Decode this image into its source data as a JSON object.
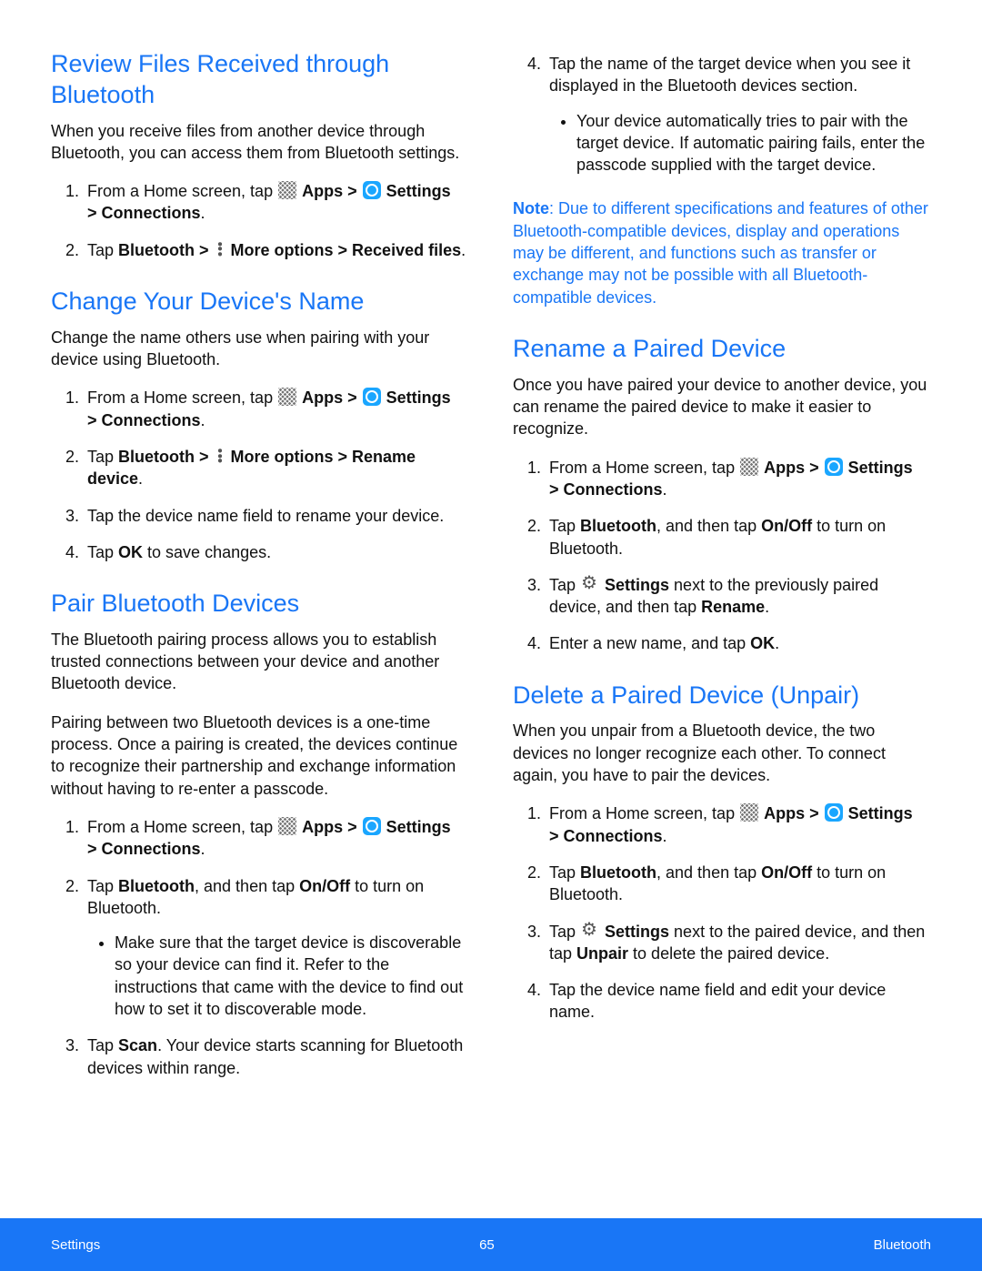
{
  "footer": {
    "left": "Settings",
    "page": "65",
    "right": "Bluetooth"
  },
  "common": {
    "apps_label": "Apps",
    "settings_label": "Settings",
    "connections": "> Connections",
    "gt": " > "
  },
  "left_col": {
    "s1": {
      "h": "Review Files Received through Bluetooth",
      "p": "When you receive files from another device through Bluetooth, you can access them from Bluetooth settings.",
      "li1_pre": "From a Home screen, tap ",
      "li1_post": ".",
      "li2_a": "Tap ",
      "li2_b": "Bluetooth > ",
      "li2_c": " More options > Received files",
      "li2_d": "."
    },
    "s2": {
      "h": "Change Your Device's Name",
      "p": "Change the name others use when pairing with your device using Bluetooth.",
      "li1_pre": "From a Home screen, tap ",
      "li2_a": "Tap ",
      "li2_b": "Bluetooth > ",
      "li2_c": " More options > Rename device",
      "li2_d": ".",
      "li3": "Tap the device name field to rename your device.",
      "li4_a": "Tap ",
      "li4_b": "OK",
      "li4_c": " to save changes."
    },
    "s3": {
      "h": "Pair Bluetooth Devices",
      "p1": "The Bluetooth pairing process allows you to establish trusted connections between your device and another Bluetooth device.",
      "p2": "Pairing between two Bluetooth devices is a one-time process. Once a pairing is created, the devices continue to recognize their partnership and exchange information without having to re-enter a passcode.",
      "li1_pre": "From a Home screen, tap ",
      "li2_a": "Tap ",
      "li2_b": "Bluetooth",
      "li2_c": ", and then tap ",
      "li2_d": "On/Off",
      "li2_e": " to turn on Bluetooth.",
      "li2_sub": "Make sure that the target device is discoverable so your device can find it. Refer to the instructions that came with the device to find out how to set it to discoverable mode.",
      "li3_a": "Tap ",
      "li3_b": "Scan",
      "li3_c": ". Your device starts scanning for Bluetooth devices within range."
    }
  },
  "right_col": {
    "s3_cont": {
      "li4": "Tap the name of the target device when you see it displayed in the Bluetooth devices section.",
      "li4_sub": "Your device automatically tries to pair with the target device. If automatic pairing fails, enter the passcode supplied with the target device."
    },
    "note_label": "Note",
    "note_body": ": Due to different specifications and features of other Bluetooth-compatible devices, display and operations may be different, and functions such as transfer or exchange may not be possible with all Bluetooth-compatible devices.",
    "s4": {
      "h": "Rename a Paired Device",
      "p": "Once you have paired your device to another device, you can rename the paired device to make it easier to recognize.",
      "li1_pre": "From a Home screen, tap ",
      "li2_a": "Tap ",
      "li2_b": "Bluetooth",
      "li2_c": ", and then tap ",
      "li2_d": "On/Off",
      "li2_e": " to turn on Bluetooth.",
      "li3_a": "Tap ",
      "li3_b": " Settings",
      "li3_c": " next to the previously paired device, and then tap ",
      "li3_d": "Rename",
      "li3_e": ".",
      "li4_a": "Enter a new name, and tap ",
      "li4_b": "OK",
      "li4_c": "."
    },
    "s5": {
      "h": "Delete a Paired Device (Unpair)",
      "p": "When you unpair from a Bluetooth device, the two devices no longer recognize each other. To connect again, you have to pair the devices.",
      "li1_pre": "From a Home screen, tap ",
      "li2_a": "Tap ",
      "li2_b": "Bluetooth",
      "li2_c": ", and then tap ",
      "li2_d": "On/Off",
      "li2_e": " to turn on Bluetooth.",
      "li3_a": "Tap ",
      "li3_b": " Settings",
      "li3_c": " next to the paired device, and then tap ",
      "li3_d": "Unpair",
      "li3_e": " to delete the paired device.",
      "li4": "Tap the device name field and edit your device name."
    }
  }
}
